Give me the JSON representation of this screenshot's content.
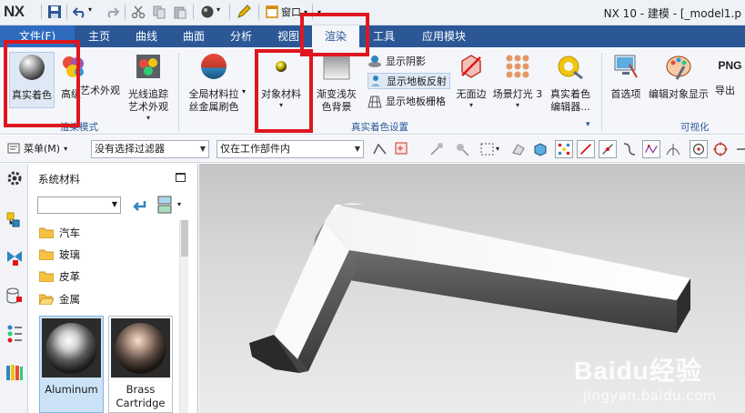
{
  "titlebar": {
    "logo": "NX",
    "window_menu_label": "窗口",
    "title": "NX 10 - 建模 - [_model1.p"
  },
  "tabs": [
    {
      "label": "文件(F)"
    },
    {
      "label": "主页"
    },
    {
      "label": "曲线"
    },
    {
      "label": "曲面"
    },
    {
      "label": "分析"
    },
    {
      "label": "视图"
    },
    {
      "label": "渲染"
    },
    {
      "label": "工具"
    },
    {
      "label": "应用模块"
    }
  ],
  "ribbon": {
    "buttons": [
      {
        "label": "真实着色",
        "icon": "real-shading-sphere-icon"
      },
      {
        "label": "高级",
        "icon": "advanced-color-balls-icon"
      },
      {
        "label": "艺术外观",
        "icon": "artistic-appearance-icon"
      },
      {
        "label": "光线追踪",
        "label2": "艺术外观",
        "icon": "ray-tracing-icon"
      },
      {
        "label": "全局材料拉",
        "label2": "丝金属刷色",
        "icon": "global-material-sphere-icon"
      },
      {
        "label": "对象材料",
        "icon": "object-material-icon"
      },
      {
        "label": "渐变浅灰",
        "label2": "色背景",
        "icon": "gradient-background-icon"
      },
      {
        "label": "无面边",
        "icon": "no-face-edges-icon"
      },
      {
        "label": "场景灯光 3",
        "icon": "scene-lights-icon"
      },
      {
        "label": "真实着色",
        "label2": "编辑器...",
        "icon": "true-shading-editor-icon"
      },
      {
        "label": "首选项",
        "icon": "preferences-icon"
      },
      {
        "label": "编辑对象显示",
        "icon": "edit-object-display-icon"
      },
      {
        "label": "导出",
        "label2": "PNG",
        "icon": "png-export-icon"
      }
    ],
    "small_buttons": [
      {
        "label": "显示阴影"
      },
      {
        "label": "显示地板反射"
      },
      {
        "label": "显示地板栅格"
      }
    ],
    "groups": {
      "render_mode": "渲染模式",
      "true_shading_settings": "真实着色设置",
      "visualize": "可视化"
    }
  },
  "toolbar": {
    "menu_label": "菜单(M)",
    "selection_filter": "没有选择过滤器",
    "scope_filter": "仅在工作部件内"
  },
  "panel": {
    "title": "系统材料",
    "folders": [
      "汽车",
      "玻璃",
      "皮革",
      "金属"
    ],
    "materials": [
      {
        "name": "Aluminum"
      },
      {
        "name": "Brass",
        "name2": "Cartridge"
      }
    ]
  },
  "watermark": {
    "brand_main": "Baidu经验",
    "brand_sub": "jingyan.baidu.com"
  },
  "colors": {
    "tab_bar": "#2b5797",
    "highlight": "#e0161e",
    "ribbon_bg": "#f4f6f9"
  }
}
